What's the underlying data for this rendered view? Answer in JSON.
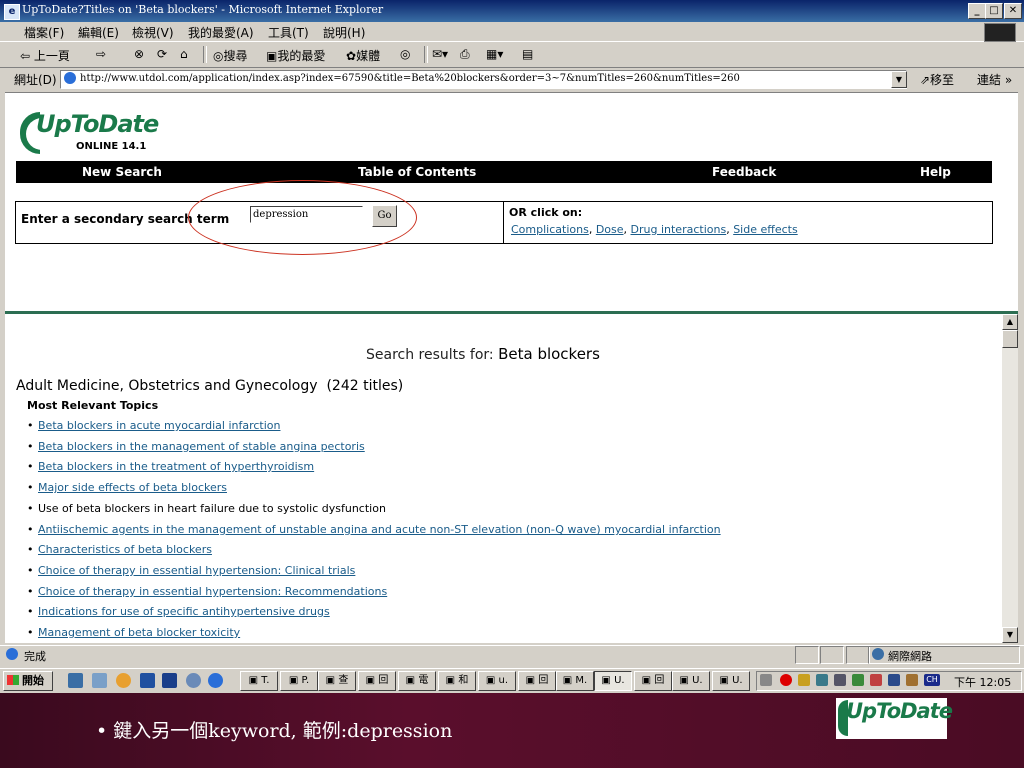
{
  "window": {
    "title": "UpToDate?Titles on 'Beta blockers' - Microsoft Internet Explorer",
    "minimize": "_",
    "maximize": "□",
    "close": "✕"
  },
  "menu": [
    "檔案(F)",
    "編輯(E)",
    "檢視(V)",
    "我的最愛(A)",
    "工具(T)",
    "說明(H)"
  ],
  "toolbar": {
    "back": "⇦ 上一頁",
    "forward": "⇨",
    "stop": "⊗",
    "refresh": "⟳",
    "home": "⌂",
    "search": "搜尋",
    "favorites": "我的最愛",
    "media": "媒體",
    "history": "◎"
  },
  "address": {
    "label": "網址(D)",
    "url": "http://www.utdol.com/application/index.asp?index=67590&title=Beta%20blockers&order=3~7&numTitles=260&numTitles=260",
    "go": "⇗移至",
    "links": "連結 »"
  },
  "logo": {
    "name": "UpToDate",
    "edition": "ONLINE 14.1"
  },
  "nav": [
    "New Search",
    "Table of Contents",
    "Feedback",
    "Help"
  ],
  "secondary_search": {
    "label": "Enter a secondary search term",
    "value": "depression",
    "button": "Go"
  },
  "or_click": {
    "label": "OR click on:",
    "links": [
      "Complications",
      "Dose",
      "Drug interactions",
      "Side effects"
    ]
  },
  "results": {
    "heading_prefix": "Search results for: ",
    "query": "Beta blockers",
    "section": "Adult Medicine, Obstetrics and Gynecology",
    "count": "(242 titles)",
    "subheading": "Most Relevant Topics",
    "topics": [
      {
        "text": "Beta blockers in acute myocardial infarction",
        "link": true
      },
      {
        "text": "Beta blockers in the management of stable angina pectoris",
        "link": true
      },
      {
        "text": "Beta blockers in the treatment of hyperthyroidism",
        "link": true
      },
      {
        "text": "Major side effects of beta blockers",
        "link": true
      },
      {
        "text": "Use of beta blockers in heart failure due to systolic dysfunction",
        "link": false
      },
      {
        "text": "Antiischemic agents in the management of unstable angina and acute non-ST elevation (non-Q wave) myocardial infarction",
        "link": true
      },
      {
        "text": "Characteristics of beta blockers",
        "link": true
      },
      {
        "text": "Choice of therapy in essential hypertension: Clinical trials",
        "link": true
      },
      {
        "text": "Choice of therapy in essential hypertension: Recommendations",
        "link": true
      },
      {
        "text": "Indications for use of specific antihypertensive drugs",
        "link": true
      },
      {
        "text": "Management of beta blocker toxicity",
        "link": true
      }
    ]
  },
  "status": {
    "text": "完成",
    "zone": "網際網路"
  },
  "taskbar": {
    "start": "開始",
    "tasks": [
      "T.",
      "P.",
      "查",
      "回",
      "電",
      "和",
      "u.",
      "回",
      "M.",
      "U.",
      "回",
      "U.",
      "U."
    ],
    "clock": "下午 12:05"
  },
  "slide": {
    "caption": "• 鍵入另一個keyword,   範例:depression",
    "logo": "UpToDate"
  }
}
